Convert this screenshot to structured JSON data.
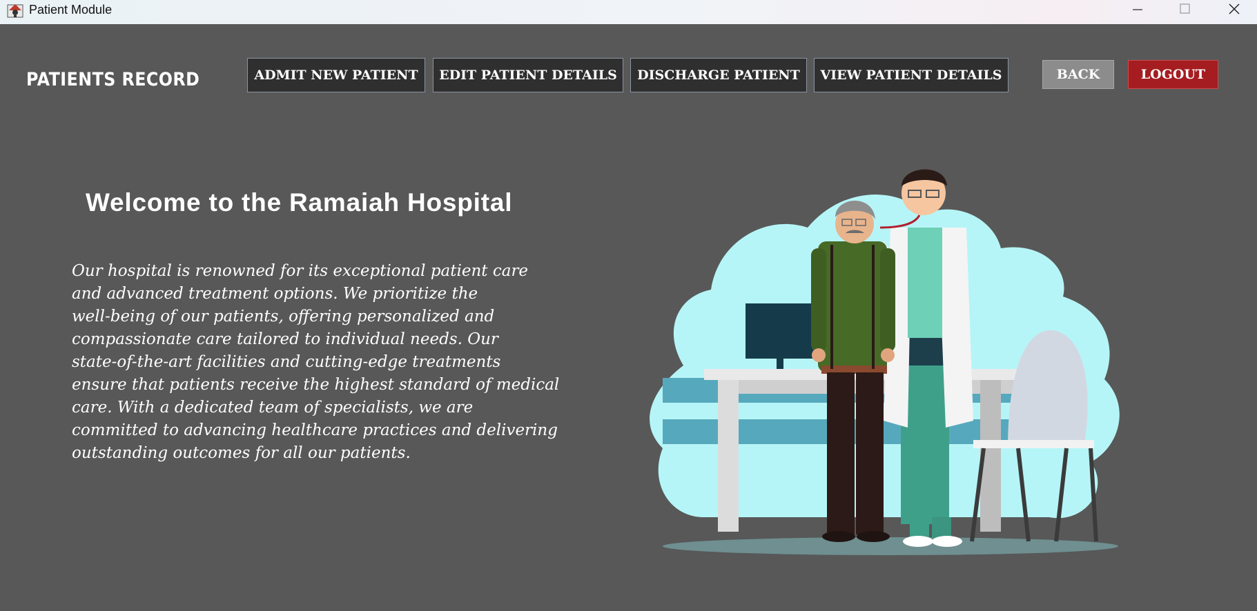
{
  "window": {
    "title": "Patient Module",
    "icon": "app-icon",
    "controls": [
      "minimize-icon",
      "maximize-icon",
      "close-icon"
    ]
  },
  "header": {
    "title": "PATIENTS RECORD",
    "nav": [
      {
        "label": "ADMIT NEW PATIENT"
      },
      {
        "label": "EDIT PATIENT DETAILS"
      },
      {
        "label": "DISCHARGE PATIENT"
      },
      {
        "label": "VIEW PATIENT DETAILS"
      }
    ],
    "back_label": "BACK",
    "logout_label": "LOGOUT"
  },
  "main": {
    "welcome": "Welcome to the Ramaiah Hospital",
    "description_lines": [
      "Our hospital is renowned for its exceptional patient care",
      "and advanced treatment options. We prioritize the",
      "well-being of our patients, offering personalized and",
      "compassionate care tailored to individual needs. Our",
      "state-of-the-art facilities and cutting-edge treatments",
      "ensure that patients receive the highest standard of medical",
      "care. With a dedicated team of specialists, we are",
      "committed to advancing healthcare practices and delivering",
      "outstanding outcomes for all our patients."
    ],
    "illustration": "doctor-examining-patient-illustration"
  },
  "colors": {
    "background": "#585858",
    "nav_button": "#2f2f2f",
    "back_button": "#8c8c8c",
    "logout_button": "#a51d21"
  }
}
